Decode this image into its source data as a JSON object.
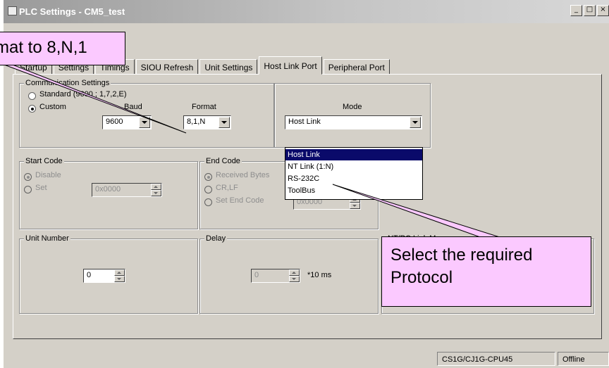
{
  "window": {
    "title": "PLC Settings - CM5_test",
    "buttons": {
      "minimize": "_",
      "maximize": "□",
      "close": "×"
    }
  },
  "tabs": [
    {
      "label": "Startup",
      "active": false
    },
    {
      "label": "Settings",
      "active": false
    },
    {
      "label": "Timings",
      "active": false
    },
    {
      "label": "SIOU Refresh",
      "active": false
    },
    {
      "label": "Unit Settings",
      "active": false
    },
    {
      "label": "Host Link Port",
      "active": true
    },
    {
      "label": "Peripheral Port",
      "active": false
    }
  ],
  "communication": {
    "title": "Communication Settings",
    "standard_label": "Standard (9600 ; 1,7,2,E)",
    "custom_label": "Custom",
    "baud_label": "Baud",
    "baud_value": "9600",
    "format_label": "Format",
    "format_value": "8,1,N",
    "selected": "custom"
  },
  "mode": {
    "label": "Mode",
    "value": "Host Link",
    "options": [
      "Host Link",
      "NT Link (1:N)",
      "RS-232C",
      "ToolBus"
    ],
    "selected_option": "Host Link"
  },
  "start_code": {
    "title": "Start Code",
    "disable_label": "Disable",
    "set_label": "Set",
    "value": "0x0000"
  },
  "end_code": {
    "title": "End Code",
    "received_label": "Received Bytes",
    "crlf_label": "CR,LF",
    "set_end_code_label": "Set End Code",
    "value": "0x0000"
  },
  "unit_number": {
    "title": "Unit Number",
    "value": "0"
  },
  "delay": {
    "title": "Delay",
    "value": "0",
    "unit": "*10 ms"
  },
  "nt_pc_link": {
    "title": "NT/PC Link Max"
  },
  "status": {
    "cpu": "CS1G/CJ1G-CPU45",
    "state": "Offline"
  },
  "callouts": {
    "format_note": "mat to 8,N,1",
    "protocol_note_line1": "Select the required",
    "protocol_note_line2": "Protocol"
  }
}
